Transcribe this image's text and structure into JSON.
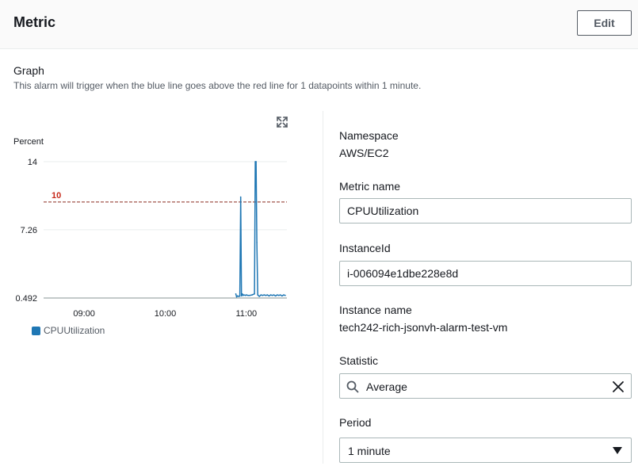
{
  "header": {
    "title": "Metric",
    "edit_label": "Edit"
  },
  "graph": {
    "title": "Graph",
    "description": "This alarm will trigger when the blue line goes above the red line for 1 datapoints within 1 minute."
  },
  "chart_data": {
    "type": "line",
    "ylabel": "Percent",
    "y_ticks": [
      0.492,
      7.26,
      14
    ],
    "y_tick_labels": [
      "0.492",
      "7.26",
      "14"
    ],
    "ylim": [
      0.492,
      14
    ],
    "x_ticks": [
      "09:00",
      "10:00",
      "11:00"
    ],
    "x_tick_hours": [
      9.0,
      10.0,
      11.0
    ],
    "xlim": [
      8.5,
      11.5
    ],
    "threshold": {
      "value": 10,
      "label": "10",
      "color": "#c7291a"
    },
    "series": [
      {
        "name": "CPUUtilization",
        "color": "#1f77b4",
        "x": [
          10.87,
          10.88,
          10.89,
          10.91,
          10.92,
          10.93,
          10.94,
          10.95,
          10.96,
          10.97,
          10.99,
          11.0,
          11.02,
          11.04,
          11.07,
          11.1,
          11.11,
          11.12,
          11.13,
          11.14,
          11.16,
          11.18,
          11.2,
          11.22,
          11.24,
          11.26,
          11.28,
          11.3,
          11.32,
          11.34,
          11.36,
          11.38,
          11.4,
          11.42,
          11.44,
          11.46,
          11.48
        ],
        "y": [
          0.9,
          0.6,
          0.7,
          0.65,
          0.7,
          10.5,
          0.7,
          0.9,
          0.75,
          0.8,
          0.75,
          0.8,
          0.75,
          0.75,
          0.8,
          0.9,
          14,
          14,
          6,
          0.8,
          0.65,
          0.8,
          0.75,
          0.8,
          0.75,
          0.8,
          0.7,
          0.8,
          0.75,
          0.8,
          0.7,
          0.8,
          0.75,
          0.8,
          0.7,
          0.8,
          0.75
        ]
      }
    ]
  },
  "fields": {
    "namespace": {
      "label": "Namespace",
      "value": "AWS/EC2"
    },
    "metric_name": {
      "label": "Metric name",
      "value": "CPUUtilization"
    },
    "instance_id": {
      "label": "InstanceId",
      "value": "i-006094e1dbe228e8d"
    },
    "instance_name": {
      "label": "Instance name",
      "value": "tech242-rich-jsonvh-alarm-test-vm"
    },
    "statistic": {
      "label": "Statistic",
      "value": "Average"
    },
    "period": {
      "label": "Period",
      "value": "1 minute"
    }
  }
}
